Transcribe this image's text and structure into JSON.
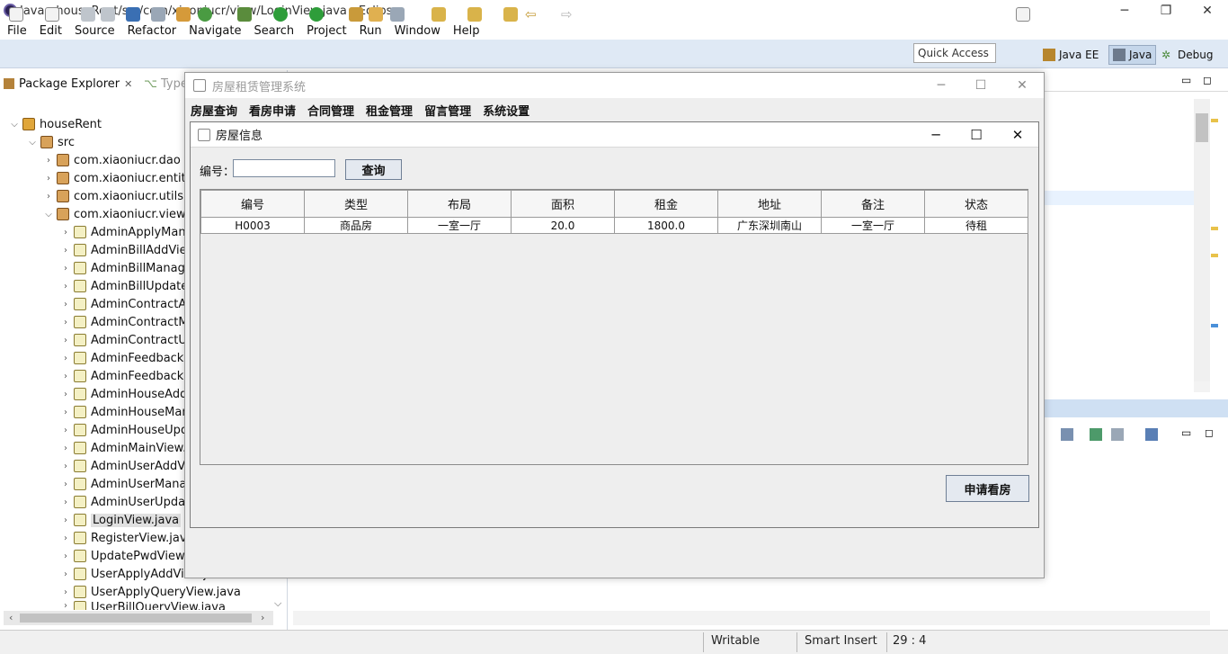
{
  "window": {
    "title": "Java - houseRent/src/com/xiaoniucr/view/LoginView.java - Eclipse"
  },
  "menu": [
    "File",
    "Edit",
    "Source",
    "Refactor",
    "Navigate",
    "Search",
    "Project",
    "Run",
    "Window",
    "Help"
  ],
  "toolbar": {
    "quick_access": "Quick Access",
    "perspectives": [
      "Java EE",
      "Java",
      "Debug"
    ]
  },
  "package_explorer": {
    "tab_label": "Package Explorer",
    "tab2_label": "Type",
    "project": "houseRent",
    "src": "src",
    "packages": [
      "com.xiaoniucr.dao",
      "com.xiaoniucr.entity",
      "com.xiaoniucr.utils",
      "com.xiaoniucr.view"
    ],
    "files": [
      "AdminApplyMana",
      "AdminBillAddView",
      "AdminBillManage",
      "AdminBillUpdateV",
      "AdminContractAd",
      "AdminContractMa",
      "AdminContractUp",
      "AdminFeedbackM",
      "AdminFeedbackR",
      "AdminHouseAddV",
      "AdminHouseMan",
      "AdminHouseUpd",
      "AdminMainView.j",
      "AdminUserAddVi",
      "AdminUserManag",
      "AdminUserUpdat",
      "LoginView.java",
      "RegisterView.java",
      "UpdatePwdView.j",
      "UserApplyAddView.java",
      "UserApplyQueryView.java",
      "UserBillQueryView.java"
    ]
  },
  "status": {
    "writable": "Writable",
    "insert_mode": "Smart Insert",
    "position": "29 : 4"
  },
  "app": {
    "title": "房屋租赁管理系统",
    "menu": [
      "房屋查询",
      "看房申请",
      "合同管理",
      "租金管理",
      "留言管理",
      "系统设置"
    ],
    "dialog": {
      "title": "房屋信息",
      "search_label": "编号：",
      "search_value": "",
      "query_button": "查询",
      "columns": [
        "编号",
        "类型",
        "布局",
        "面积",
        "租金",
        "地址",
        "备注",
        "状态"
      ],
      "rows": [
        [
          "H0003",
          "商品房",
          "一室一厅",
          "20.0",
          "1800.0",
          "广东深圳南山",
          "一室一厅",
          "待租"
        ]
      ],
      "apply_button": "申请看房"
    }
  }
}
